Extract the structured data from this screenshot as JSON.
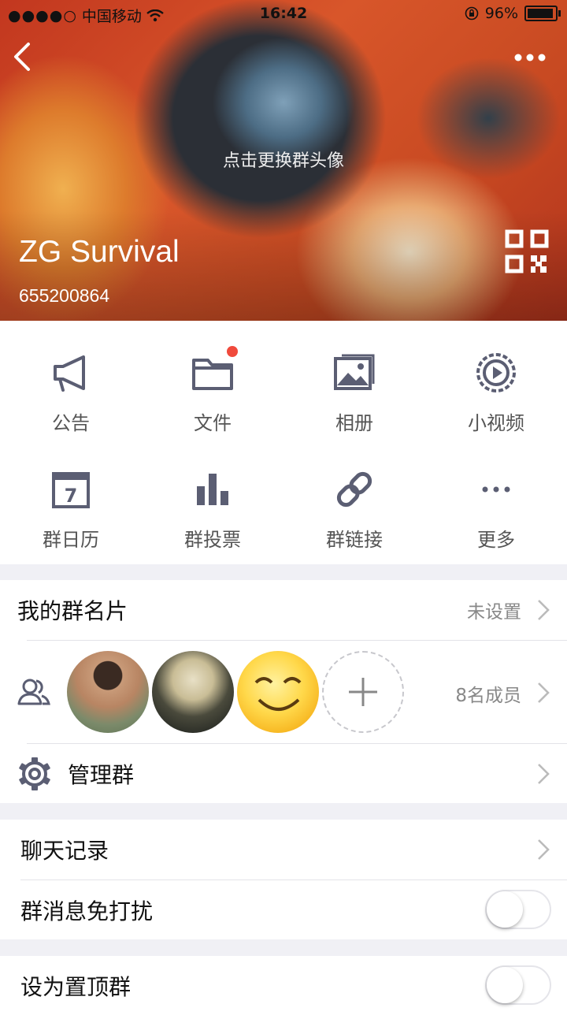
{
  "status_bar": {
    "carrier": "中国移动",
    "time": "16:42",
    "battery": "96%"
  },
  "header": {
    "change_avatar_hint": "点击更换群头像",
    "group_name": "ZG Survival",
    "group_id": "655200864"
  },
  "grid": {
    "announcement": "公告",
    "files": "文件",
    "album": "相册",
    "short_video": "小视频",
    "calendar": "群日历",
    "calendar_day": "7",
    "vote": "群投票",
    "link": "群链接",
    "more": "更多"
  },
  "card_name": {
    "label": "我的群名片",
    "value": "未设置"
  },
  "members": {
    "count_label": "8名成员"
  },
  "manage": {
    "label": "管理群"
  },
  "chat_history": {
    "label": "聊天记录"
  },
  "mute": {
    "label": "群消息免打扰",
    "enabled": false
  },
  "pin": {
    "label": "设为置顶群",
    "enabled": false
  },
  "colors": {
    "icon": "#5b5e73",
    "accent_dot": "#f04a3c",
    "background": "#f0f0f5"
  }
}
